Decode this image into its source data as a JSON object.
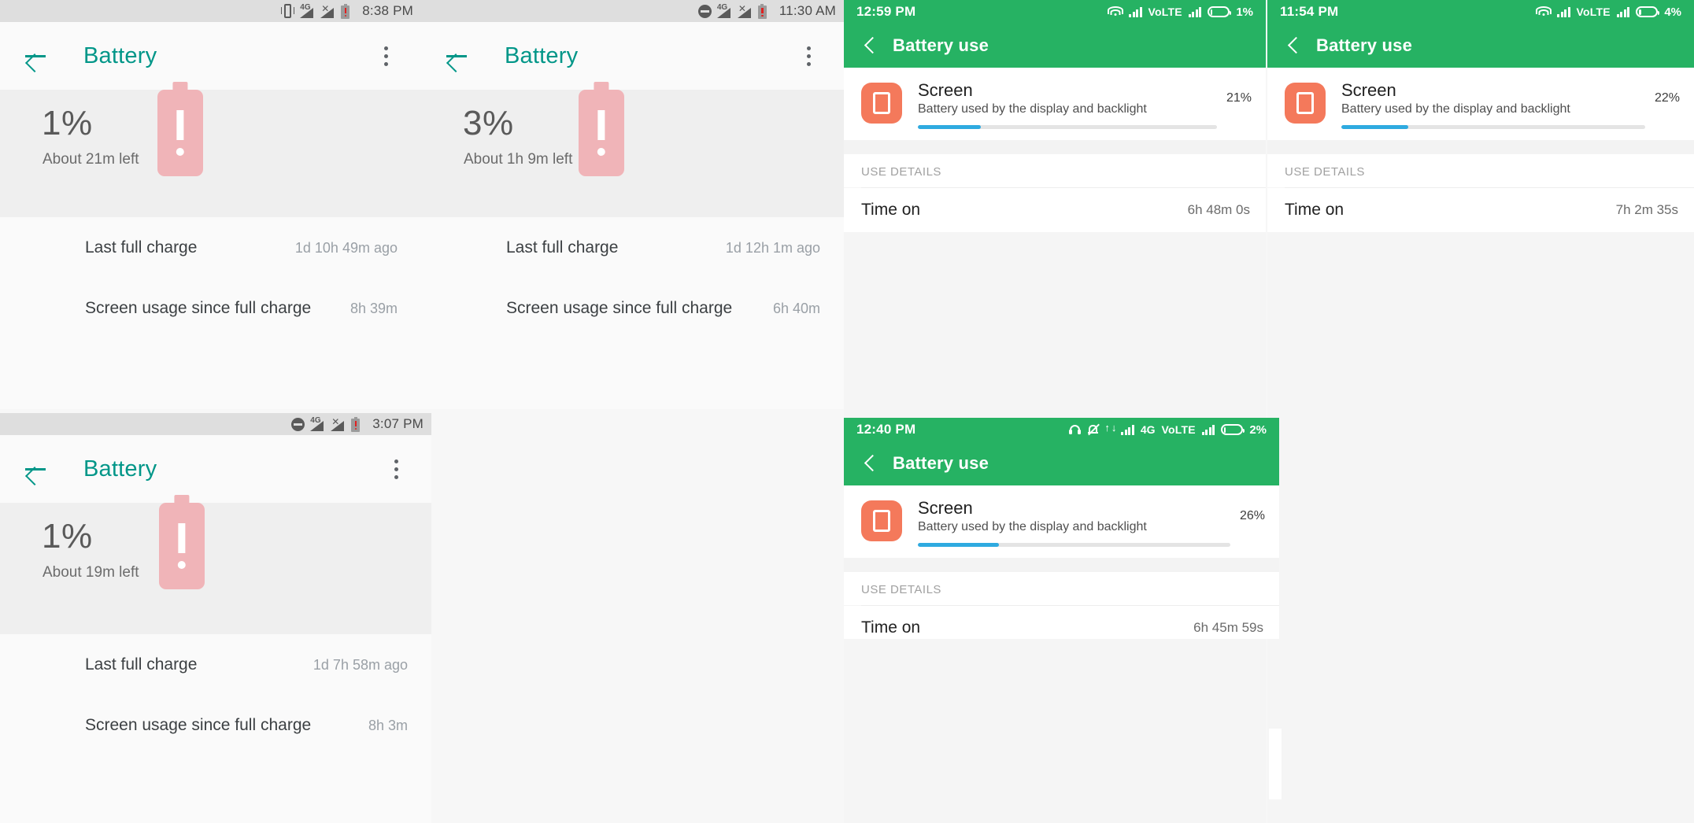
{
  "theme": {
    "accent_teal": "#009688",
    "miui_green": "#26b263",
    "app_icon_orange": "#f4795b",
    "progress_blue": "#2eaae0",
    "battery_pink": "#f0b4b8",
    "low_battery_red": "#e02020"
  },
  "panels": {
    "android_1": {
      "status_bar": {
        "time": "8:38 PM",
        "icons": [
          "vibrate-icon",
          "signal-4g-icon",
          "signal-no-service-icon",
          "battery-low-icon"
        ]
      },
      "app_bar": {
        "back": "back-arrow-icon",
        "title": "Battery",
        "overflow": "overflow-menu-icon"
      },
      "hero": {
        "percent": "1%",
        "estimate": "About 21m left",
        "battery_glyph": "battery-alert-icon"
      },
      "rows": [
        {
          "label": "Last full charge",
          "value": "1d 10h 49m ago"
        },
        {
          "label": "Screen usage since full charge",
          "value": "8h 39m"
        }
      ]
    },
    "android_2": {
      "status_bar": {
        "time": "11:30 AM",
        "icons": [
          "do-not-disturb-icon",
          "signal-4g-icon",
          "signal-no-service-icon",
          "battery-low-icon"
        ]
      },
      "app_bar": {
        "back": "back-arrow-icon",
        "title": "Battery",
        "overflow": "overflow-menu-icon"
      },
      "hero": {
        "percent": "3%",
        "estimate": "About 1h 9m left",
        "battery_glyph": "battery-alert-icon"
      },
      "rows": [
        {
          "label": "Last full charge",
          "value": "1d 12h 1m ago"
        },
        {
          "label": "Screen usage since full charge",
          "value": "6h 40m"
        }
      ]
    },
    "android_3": {
      "status_bar": {
        "time": "3:07 PM",
        "icons": [
          "do-not-disturb-icon",
          "signal-4g-icon",
          "signal-no-service-icon",
          "battery-low-icon"
        ]
      },
      "app_bar": {
        "back": "back-arrow-icon",
        "title": "Battery",
        "overflow": "overflow-menu-icon"
      },
      "hero": {
        "percent": "1%",
        "estimate": "About 19m left",
        "battery_glyph": "battery-alert-icon"
      },
      "rows": [
        {
          "label": "Last full charge",
          "value": "1d 7h 58m ago"
        },
        {
          "label": "Screen usage since full charge",
          "value": "8h 3m"
        }
      ]
    },
    "miui_1": {
      "status_bar": {
        "time": "12:59 PM",
        "volte": "VoLTE",
        "battery_percent": "1%",
        "icons": [
          "wifi-icon",
          "signal-icon",
          "volte-label",
          "signal-icon",
          "battery-icon"
        ]
      },
      "header": {
        "back": "back-chevron-icon",
        "title": "Battery use"
      },
      "app": {
        "icon": "screen-app-icon",
        "name": "Screen",
        "description": "Battery used by the display and backlight",
        "percent": "21%",
        "bar_fill_ratio": 0.21
      },
      "section_label": "USE DETAILS",
      "details": [
        {
          "label": "Time on",
          "value": "6h 48m 0s"
        }
      ]
    },
    "miui_2": {
      "status_bar": {
        "time": "11:54 PM",
        "volte": "VoLTE",
        "battery_percent": "4%",
        "icons": [
          "wifi-icon",
          "signal-icon",
          "volte-label",
          "signal-icon",
          "battery-icon"
        ]
      },
      "header": {
        "back": "back-chevron-icon",
        "title": "Battery use"
      },
      "app": {
        "icon": "screen-app-icon",
        "name": "Screen",
        "description": "Battery used by the display and backlight",
        "percent": "22%",
        "bar_fill_ratio": 0.22
      },
      "section_label": "USE DETAILS",
      "details": [
        {
          "label": "Time on",
          "value": "7h 2m 35s"
        }
      ]
    },
    "miui_3": {
      "status_bar": {
        "time": "12:40 PM",
        "network": "4G",
        "volte": "VoLTE",
        "battery_percent": "2%",
        "icons": [
          "headphones-icon",
          "mute-bell-icon",
          "data-transfer-icon",
          "signal-icon",
          "network-4g-label",
          "volte-label",
          "signal-icon",
          "battery-icon"
        ]
      },
      "header": {
        "back": "back-chevron-icon",
        "title": "Battery use"
      },
      "app": {
        "icon": "screen-app-icon",
        "name": "Screen",
        "description": "Battery used by the display and backlight",
        "percent": "26%",
        "bar_fill_ratio": 0.26
      },
      "section_label": "USE DETAILS",
      "details": [
        {
          "label": "Time on",
          "value": "6h 45m 59s"
        }
      ]
    }
  }
}
